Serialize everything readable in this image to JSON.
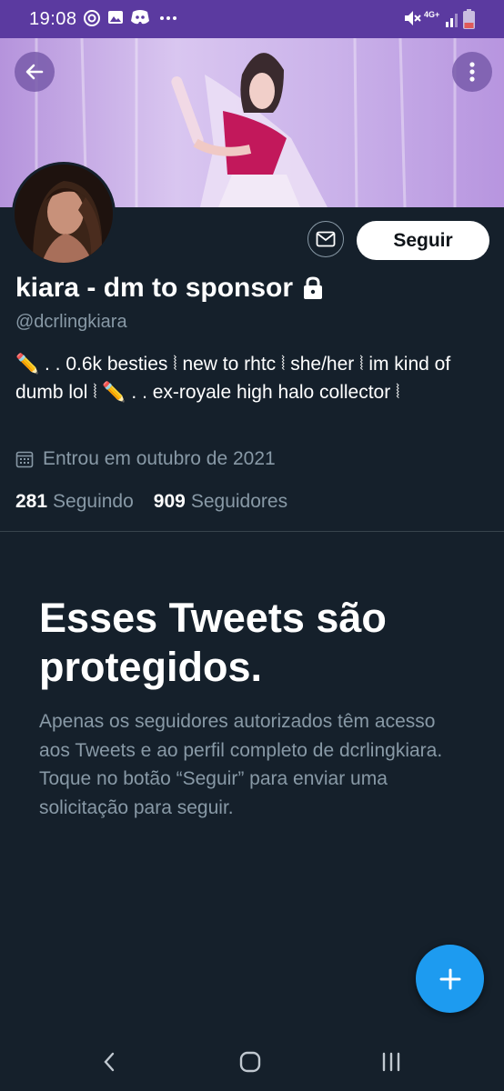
{
  "status_bar": {
    "time": "19:08",
    "network": "4G+",
    "icons": [
      "threads-icon",
      "gallery-icon",
      "discord-icon",
      "more-dots-icon",
      "mute-icon",
      "signal-icon",
      "battery-icon"
    ]
  },
  "profile": {
    "name": "kiara - dm to sponsor",
    "handle": "@dcrlingkiara",
    "bio": "✏️ . . 0.6k besties ⦚ new to rhtc ⦚ she/her ⦚ im kind of dumb lol ⦚ ✏️ . . ex-royale high halo collector ⦚",
    "joined": "Entrou em outubro de 2021",
    "following_count": "281",
    "following_label": "Seguindo",
    "followers_count": "909",
    "followers_label": "Seguidores",
    "follow_label": "Seguir"
  },
  "protected": {
    "title": "Esses Tweets são protegidos.",
    "body": "Apenas os seguidores autorizados têm acesso aos Tweets e ao perfil completo de dcrlingkiara. Toque no botão “Seguir” para enviar uma solicitação para seguir."
  },
  "colors": {
    "background": "#15202b",
    "status_bar": "#5b3aa0",
    "muted_text": "#8899a6",
    "accent": "#1d9bf0"
  }
}
